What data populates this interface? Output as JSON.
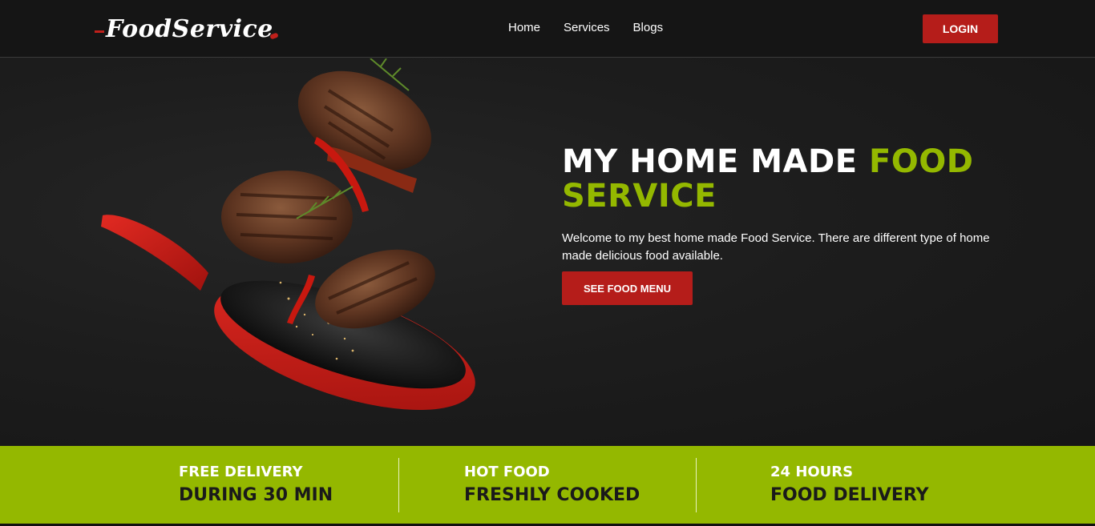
{
  "nav": {
    "logo": "FoodService",
    "links": [
      "Home",
      "Services",
      "Blogs"
    ],
    "login_label": "LOGIN"
  },
  "hero": {
    "title_white": "MY HOME MADE ",
    "title_accent_1": "FOOD",
    "title_accent_2": "SERVICE",
    "description": "Welcome to my best home made Food Service. There are different type of home made delicious food available.",
    "button_label": "SEE FOOD MENU"
  },
  "features": [
    {
      "top": "FREE DELIVERY",
      "bottom": "DURING 30 MIN"
    },
    {
      "top": "HOT FOOD",
      "bottom": "FRESHLY COOKED"
    },
    {
      "top": "24 HOURS",
      "bottom": "FOOD DELIVERY"
    }
  ],
  "colors": {
    "accent_green": "#94b800",
    "brand_red": "#b51d1a",
    "nav_bg": "#151515"
  }
}
